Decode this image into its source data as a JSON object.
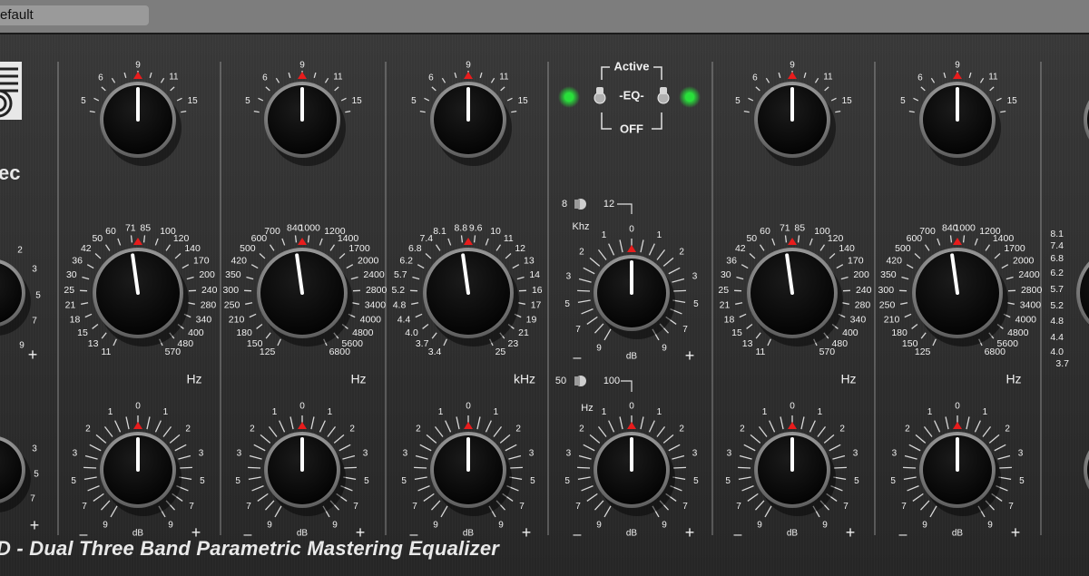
{
  "window": {
    "preset_label": "efault"
  },
  "brand": {
    "logo_text": "ec"
  },
  "product_title": "D - Dual Three Band Parametric Mastering Equalizer",
  "eq_switch": {
    "top_label": "Active",
    "middle_label": "EQ",
    "bottom_label": "OFF",
    "led_color": "#28e03a"
  },
  "ranges": {
    "high_low": "8",
    "high_high": "12",
    "high_unit": "Khz",
    "low_low": "50",
    "low_high": "100",
    "low_unit": "Hz"
  },
  "q_scale": [
    "5",
    "6",
    "9",
    "11",
    "15"
  ],
  "gain_scale": [
    "9",
    "7",
    "5",
    "3",
    "2",
    "1",
    "0",
    "1",
    "2",
    "3",
    "5",
    "7",
    "9"
  ],
  "gain_unit": "dB",
  "sign_minus": "–",
  "sign_plus": "+",
  "freq_low": {
    "unit": "Hz",
    "labels": [
      "11",
      "13",
      "15",
      "18",
      "21",
      "25",
      "30",
      "36",
      "42",
      "50",
      "60",
      "71",
      "85",
      "100",
      "120",
      "140",
      "170",
      "200",
      "240",
      "280",
      "340",
      "400",
      "480",
      "570"
    ]
  },
  "freq_mid": {
    "unit": "Hz",
    "labels": [
      "125",
      "150",
      "180",
      "210",
      "250",
      "300",
      "350",
      "420",
      "500",
      "600",
      "700",
      "840",
      "1000",
      "1200",
      "1400",
      "1700",
      "2000",
      "2400",
      "2800",
      "3400",
      "4000",
      "4800",
      "5600",
      "6800"
    ]
  },
  "freq_high": {
    "unit": "kHz",
    "labels": [
      "3.4",
      "3.7",
      "4.0",
      "4.4",
      "4.8",
      "5.2",
      "5.7",
      "6.2",
      "6.8",
      "7.4",
      "8.1",
      "8.8",
      "9.6",
      "10",
      "11",
      "12",
      "13",
      "14",
      "16",
      "17",
      "19",
      "21",
      "23",
      "25"
    ]
  },
  "left_partial_gain": [
    "2",
    "3",
    "5",
    "7",
    "9"
  ],
  "right_partial_freq": [
    "8.1",
    "7.4",
    "6.8",
    "6.2",
    "5.7",
    "5.2",
    "4.8",
    "4.4",
    "4.0",
    "3.7"
  ]
}
